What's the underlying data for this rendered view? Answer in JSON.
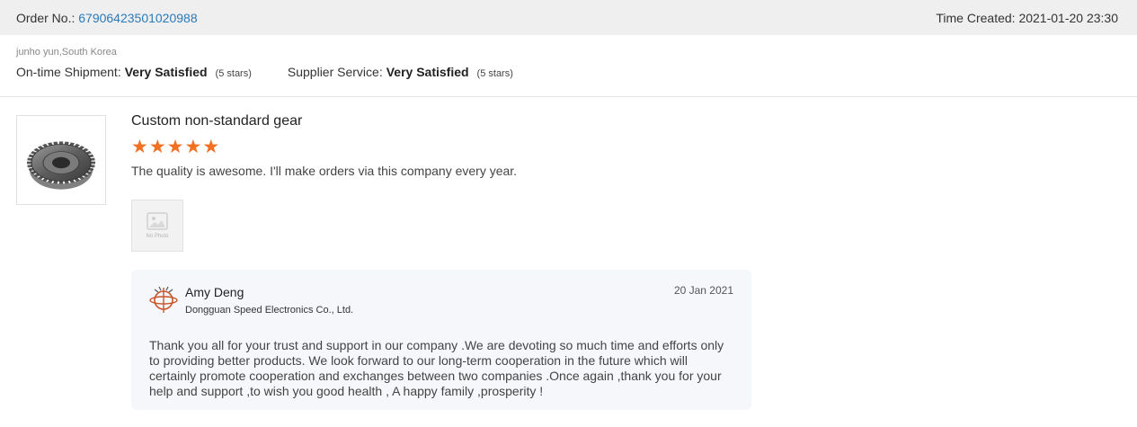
{
  "order": {
    "label": "Order No.:",
    "number": "67906423501020988",
    "time_label": "Time Created:",
    "time_value": "2021-01-20 23:30"
  },
  "buyer": {
    "name_location": "junho yun,South Korea"
  },
  "ratings": [
    {
      "label": "On-time Shipment:",
      "value": "Very Satisfied",
      "stars_text": "(5 stars)"
    },
    {
      "label": "Supplier Service:",
      "value": "Very Satisfied",
      "stars_text": "(5 stars)"
    }
  ],
  "review": {
    "product_title": "Custom non-standard gear",
    "rating": 5,
    "star_color": "#f36f21",
    "text": "The quality is awesome. I'll make orders via this company every year.",
    "photo_placeholder_label": "No Photo"
  },
  "reply": {
    "name": "Amy Deng",
    "company": "Dongguan Speed Electronics Co., Ltd.",
    "date": "20 Jan 2021",
    "text": "Thank you all for your trust and support in our company .We are devoting so much time and efforts only to providing better products. We look forward to our long-term cooperation in the future which will certainly promote cooperation and exchanges between two companies .Once again ,thank you for your help and support ,to wish you good health , A happy family ,prosperity !"
  },
  "colors": {
    "header_bg": "#efefef",
    "link": "#2a7ab8",
    "star": "#f36f21",
    "reply_bg": "#f5f7fa",
    "logo": "#c9542a"
  }
}
